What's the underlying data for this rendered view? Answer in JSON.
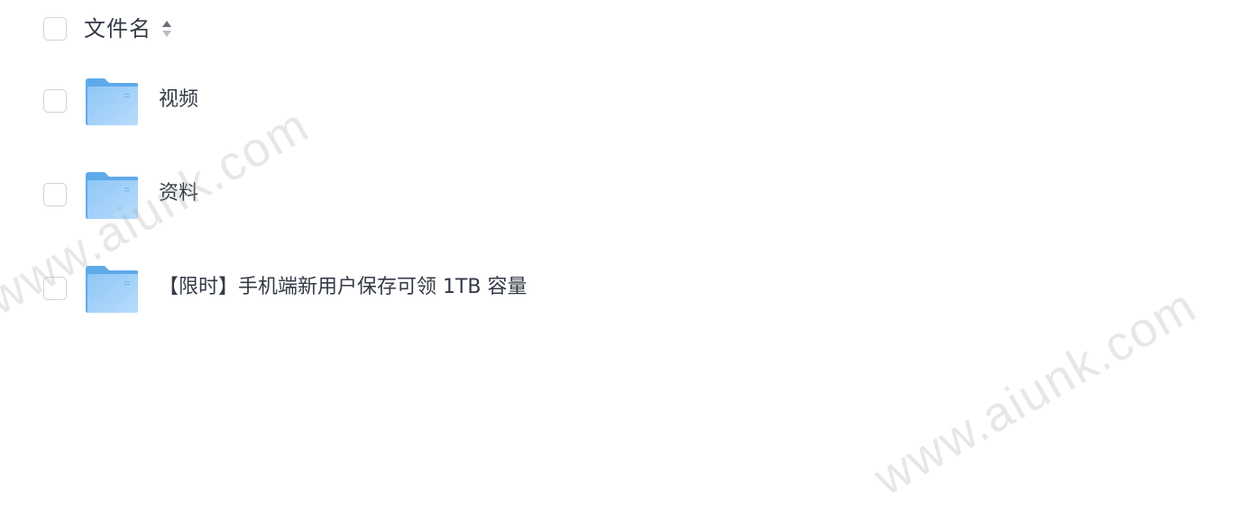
{
  "header": {
    "column_label": "文件名"
  },
  "files": [
    {
      "name": "视频",
      "icon": "folder-icon"
    },
    {
      "name": "资料",
      "icon": "folder-icon"
    },
    {
      "name": "【限时】手机端新用户保存可领 1TB 容量",
      "icon": "folder-icon"
    }
  ],
  "watermark": {
    "text": "www.aiunk.com"
  },
  "colors": {
    "folder_light": "#a8d2f8",
    "folder_dark": "#5aa8ea",
    "text": "#333a45",
    "checkbox_border": "#cfd2d8"
  }
}
